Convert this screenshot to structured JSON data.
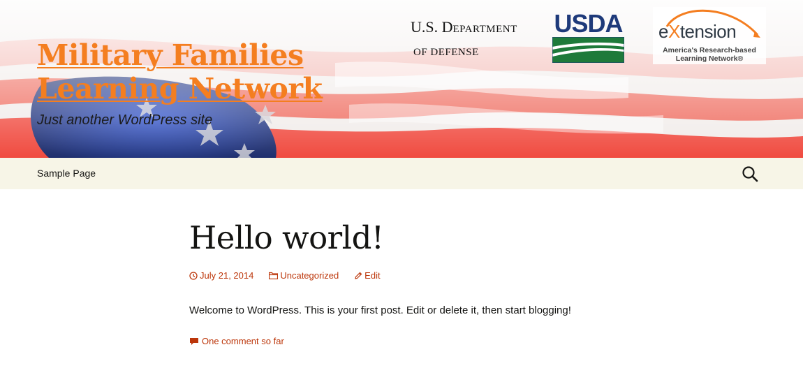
{
  "header": {
    "site_title_line1": "Military Families",
    "site_title_line2": "Learning Network",
    "site_description": "Just another WordPress site",
    "title_color": "#f47e20"
  },
  "logos": {
    "dod": {
      "line1_U": "U.S. D",
      "line1_rest": "EPARTMENT",
      "line2_O": "OF D",
      "line2_rest": "EFENSE"
    },
    "usda": {
      "text": "USDA"
    },
    "extension": {
      "word_e": "e",
      "word_x": "X",
      "word_rest": "tension",
      "tagline_line1": "America's Research-based",
      "tagline_line2": "Learning Network®"
    }
  },
  "nav": {
    "items": [
      {
        "label": "Sample Page"
      }
    ],
    "search_icon": "search-icon",
    "background": "#f7f5e7"
  },
  "post": {
    "title": "Hello world!",
    "meta": {
      "date": "July 21, 2014",
      "category": "Uncategorized",
      "edit": "Edit"
    },
    "content": "Welcome to WordPress. This is your first post. Edit or delete it, then start blogging!",
    "comments": "One comment so far",
    "link_color": "#bc360a"
  }
}
